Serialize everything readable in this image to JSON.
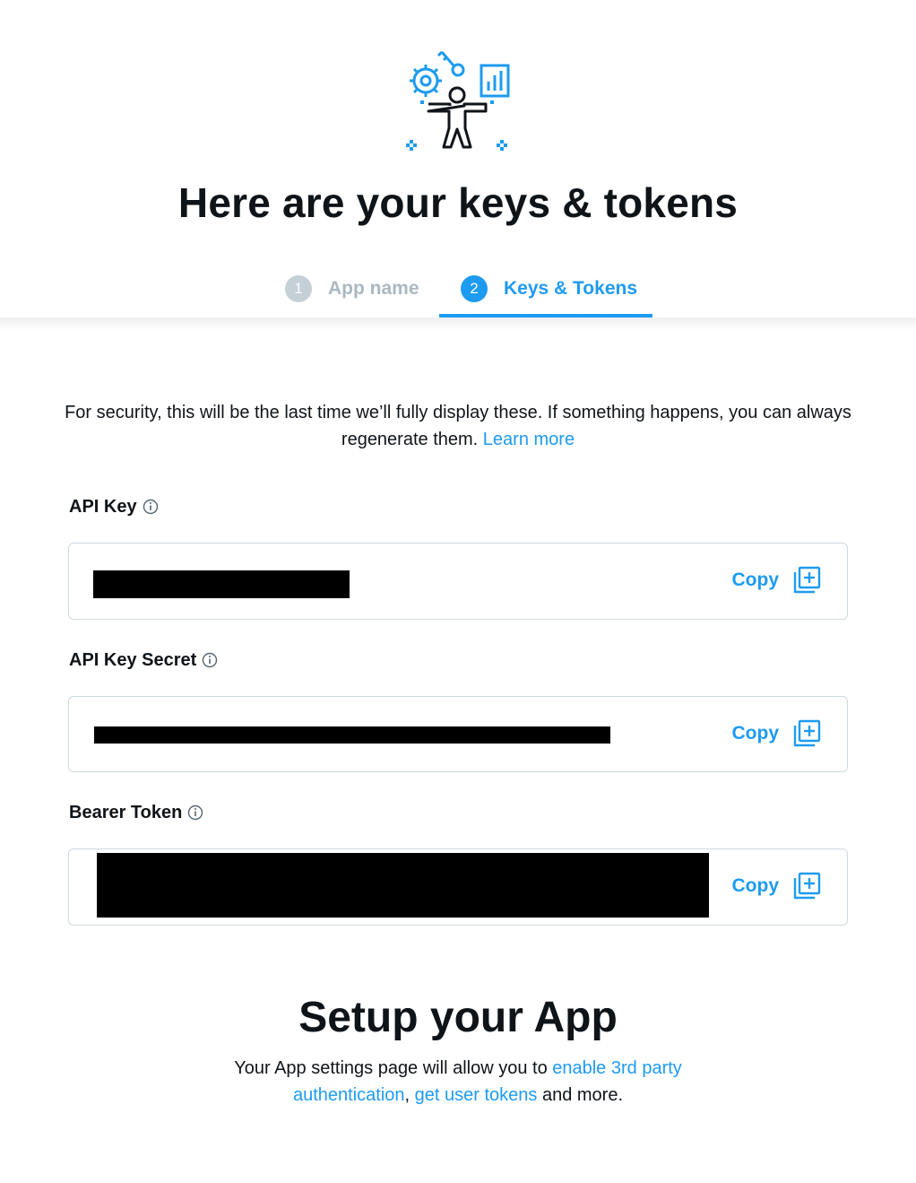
{
  "hero": {
    "title": "Here are your keys & tokens"
  },
  "stepper": {
    "steps": [
      {
        "number": "1",
        "label": "App name",
        "state": "inactive"
      },
      {
        "number": "2",
        "label": "Keys & Tokens",
        "state": "active"
      }
    ]
  },
  "notice": {
    "text": "For security, this will be the last time we’ll fully display these. If something happens, you can always regenerate them.",
    "link": "Learn more"
  },
  "fields": [
    {
      "label": "API Key",
      "value_state": "redacted",
      "copy_label": "Copy"
    },
    {
      "label": "API Key Secret",
      "value_state": "redacted",
      "copy_label": "Copy"
    },
    {
      "label": "Bearer Token",
      "value_state": "redacted",
      "copy_label": "Copy"
    }
  ],
  "setup": {
    "title": "Setup your App",
    "text_before": "Your App settings page will allow you to",
    "link_1": "enable 3rd party authentication",
    "separator": ",",
    "link_2": "get user tokens",
    "text_after": "and more."
  },
  "colors": {
    "accent": "#1d9bf0",
    "text": "#0f1419",
    "inactive_step": "#c4cfd6",
    "border": "#cfd9de"
  },
  "icons": [
    "developer-illustration",
    "info-icon",
    "copy-icon"
  ]
}
